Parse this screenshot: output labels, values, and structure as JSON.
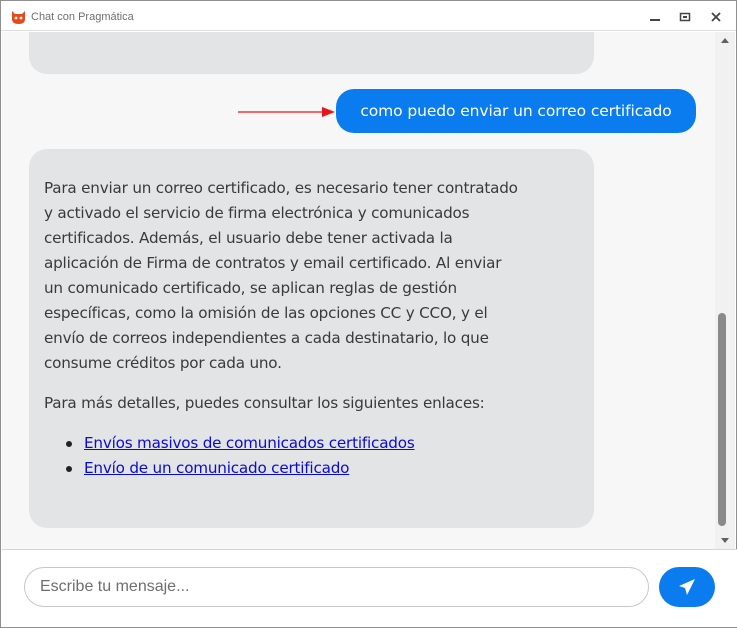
{
  "window": {
    "title": "Chat con Pragmática",
    "icons": {
      "app": "cat-logo-icon",
      "minimize": "minimize-icon",
      "maximize": "maximize-icon",
      "close": "close-icon"
    }
  },
  "chat": {
    "user_message": "como puedo enviar un correo certificado",
    "bot_message": {
      "paragraph_1": "Para enviar un correo certificado, es necesario tener contratado y activado el servicio de firma electrónica y comunicados certificados. Además, el usuario debe tener activada la aplicación de Firma de contratos y email certificado. Al enviar un comunicado certificado, se aplican reglas de gestión específicas, como la omisión de las opciones CC y CCO, y el envío de correos independientes a cada destinatario, lo que consume créditos por cada uno.",
      "paragraph_2": "Para más detalles, puedes consultar los siguientes enlaces:",
      "links": [
        "Envíos masivos de comunicados certificados",
        "Envío de un comunicado certificado"
      ]
    }
  },
  "composer": {
    "placeholder": "Escribe tu mensaje...",
    "send_icon": "paper-plane-icon"
  },
  "colors": {
    "accent": "#0a7cf0",
    "bubble_bg": "#e3e4e6",
    "link": "#0b0bd6",
    "annotation_arrow": "#e8141c"
  }
}
